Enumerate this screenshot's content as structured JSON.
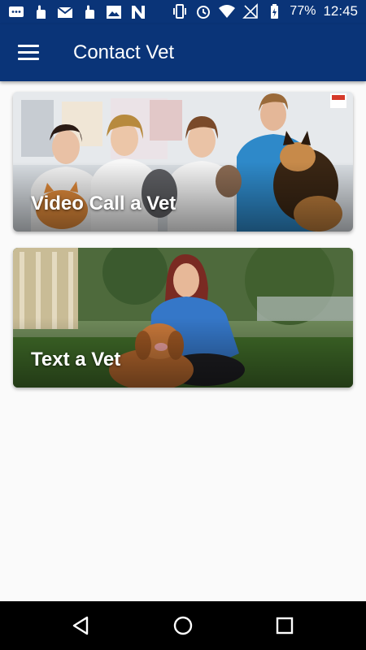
{
  "status_bar": {
    "battery": "77%",
    "time": "12:45",
    "notification_icons": [
      "chat-icon",
      "hand-icon",
      "gmail-icon",
      "hand-icon",
      "image-icon",
      "n-icon"
    ],
    "system_icons": [
      "vibrate-icon",
      "alarm-icon",
      "wifi-icon",
      "signal-icon",
      "battery-icon"
    ]
  },
  "app_bar": {
    "title": "Contact Vet",
    "color": "#0a3478"
  },
  "cards": [
    {
      "label": "Video Call a Vet"
    },
    {
      "label": "Text a Vet"
    }
  ],
  "nav_bar": {
    "buttons": [
      "back-icon",
      "home-icon",
      "recents-icon"
    ]
  }
}
